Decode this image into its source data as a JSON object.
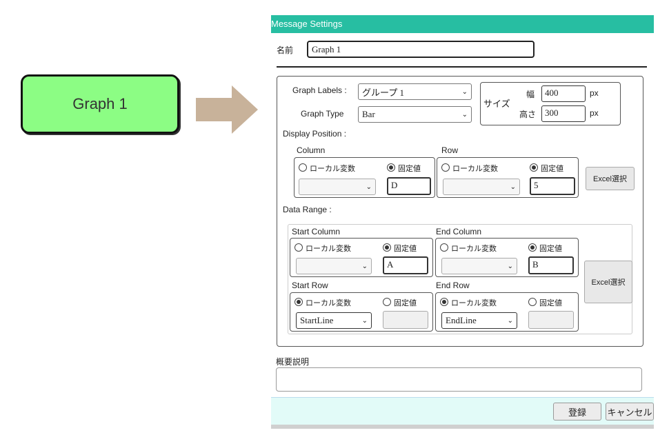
{
  "preview": {
    "node_label": "Graph 1"
  },
  "dialog": {
    "title": "Message Settings",
    "name_label": "名前",
    "name_value": "Graph 1",
    "graph_labels_label": "Graph Labels :",
    "graph_labels_value": "グループ 1",
    "graph_type_label": "Graph Type",
    "graph_type_value": "Bar",
    "size": {
      "label": "サイズ",
      "width_label": "幅",
      "width_value": "400",
      "height_label": "高さ",
      "height_value": "300",
      "unit": "px"
    },
    "display_position_label": "Display Position :",
    "column": {
      "label": "Column",
      "local_label": "ローカル変数",
      "fixed_label": "固定値",
      "fixed_value": "D",
      "selected": "fixed"
    },
    "row": {
      "label": "Row",
      "local_label": "ローカル変数",
      "fixed_label": "固定値",
      "fixed_value": "5",
      "selected": "fixed"
    },
    "excel_button": "Excel選択",
    "data_range_label": "Data Range :",
    "start_column": {
      "label": "Start Column",
      "local_label": "ローカル変数",
      "fixed_label": "固定値",
      "fixed_value": "A",
      "selected": "fixed"
    },
    "end_column": {
      "label": "End Column",
      "local_label": "ローカル変数",
      "fixed_label": "固定値",
      "fixed_value": "B",
      "selected": "fixed"
    },
    "start_row": {
      "label": "Start Row",
      "local_label": "ローカル変数",
      "fixed_label": "固定値",
      "local_value": "StartLine",
      "selected": "local"
    },
    "end_row": {
      "label": "End Row",
      "local_label": "ローカル変数",
      "fixed_label": "固定値",
      "local_value": "EndLine",
      "selected": "local"
    },
    "excel_button_2": "Excel選択",
    "description_label": "概要説明",
    "description_value": "",
    "register_button": "登録",
    "cancel_button": "キャンセル"
  },
  "colors": {
    "title_bar": "#27bea2",
    "node_fill": "#8cfd84",
    "arrow": "#c8b29a",
    "footer": "#e2fbf8"
  },
  "icons": {
    "arrow": "right-arrow-icon",
    "dropdown": "chevron-down-icon"
  }
}
